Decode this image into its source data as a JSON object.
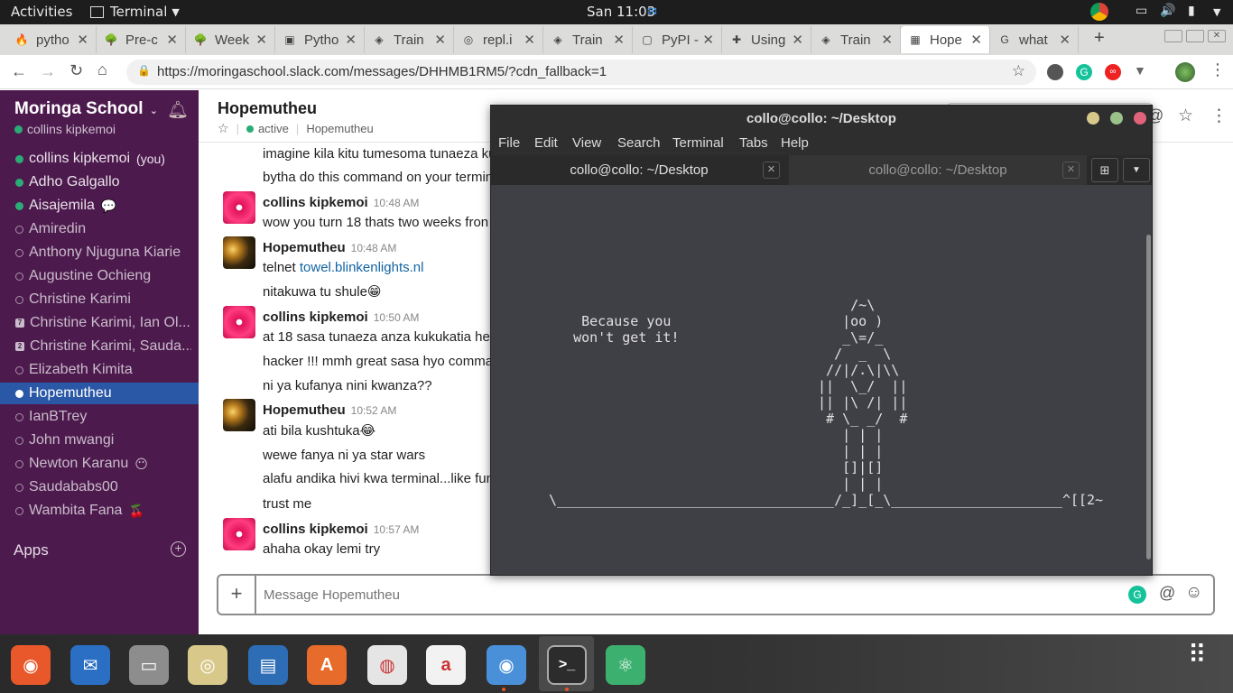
{
  "system": {
    "activities": "Activities",
    "app": "Terminal",
    "clock": "San 11:03"
  },
  "browser": {
    "tabs": [
      {
        "label": "pytho",
        "fav": "🔥"
      },
      {
        "label": "Pre-c",
        "fav": "🌳"
      },
      {
        "label": "Week",
        "fav": "🌳"
      },
      {
        "label": "Pytho",
        "fav": "▣"
      },
      {
        "label": "Train",
        "fav": "◈"
      },
      {
        "label": "repl.i",
        "fav": "◎"
      },
      {
        "label": "Train",
        "fav": "◈"
      },
      {
        "label": "PyPI -",
        "fav": "▢"
      },
      {
        "label": "Using",
        "fav": "✚"
      },
      {
        "label": "Train",
        "fav": "◈"
      },
      {
        "label": "Hope",
        "fav": "▦"
      },
      {
        "label": "what",
        "fav": "G"
      }
    ],
    "url": "https://moringaschool.slack.com/messages/DHHMB1RM5/?cdn_fallback=1"
  },
  "slack": {
    "workspace": "Moringa School",
    "user": "collins kipkemoi",
    "members": [
      {
        "name": "collins kipkemoi",
        "suffix": "(you)",
        "status": "on"
      },
      {
        "name": "Adho Galgallo",
        "suffix": "",
        "status": "on"
      },
      {
        "name": "Aisajemila",
        "suffix": "💬",
        "status": "on"
      },
      {
        "name": "Amiredin",
        "suffix": "",
        "status": "off"
      },
      {
        "name": "Anthony Njuguna Kiarie",
        "suffix": "",
        "status": "off"
      },
      {
        "name": "Augustine Ochieng",
        "suffix": "",
        "status": "off"
      },
      {
        "name": "Christine Karimi",
        "suffix": "",
        "status": "off"
      },
      {
        "name": "Christine Karimi, Ian Ol...",
        "suffix": "",
        "status": "num",
        "num": "7"
      },
      {
        "name": "Christine Karimi, Sauda...",
        "suffix": "",
        "status": "num",
        "num": "2"
      },
      {
        "name": "Elizabeth Kimita",
        "suffix": "",
        "status": "off"
      },
      {
        "name": "Hopemutheu",
        "suffix": "",
        "status": "sel"
      },
      {
        "name": "IanBTrey",
        "suffix": "",
        "status": "off"
      },
      {
        "name": "John mwangi",
        "suffix": "",
        "status": "off"
      },
      {
        "name": "Newton Karanu",
        "suffix": "😶",
        "status": "off"
      },
      {
        "name": "Saudababs00",
        "suffix": "",
        "status": "off"
      },
      {
        "name": "Wambita Fana",
        "suffix": "🍒",
        "status": "off"
      }
    ],
    "apps_label": "Apps",
    "channel": {
      "name": "Hopemutheu",
      "status": "active",
      "full_name": "Hopemutheu"
    },
    "messages": [
      {
        "text": "imagine kila kitu tumesoma tunaeza ku"
      },
      {
        "text": "bytha do this command on your termin"
      },
      {
        "author": "collins kipkemoi",
        "time": "10:48 AM",
        "avatar": "pink",
        "text": "wow you turn 18 thats two weeks fron"
      },
      {
        "author": "Hopemutheu",
        "time": "10:48 AM",
        "avatar": "dark",
        "text_prefix": "telnet ",
        "link": "towel.blinkenlights.nl"
      },
      {
        "text": "nitakuwa tu shule😁"
      },
      {
        "author": "collins kipkemoi",
        "time": "10:50 AM",
        "avatar": "pink",
        "text": "at 18 sasa tunaeza anza kukukatia heh"
      },
      {
        "text": "hacker !!! mmh great sasa hyo comman"
      },
      {
        "text": "ni ya kufanya nini kwanza??"
      },
      {
        "author": "Hopemutheu",
        "time": "10:52 AM",
        "avatar": "dark",
        "text": "ati bila kushtuka😂"
      },
      {
        "text": "wewe fanya ni ya star wars"
      },
      {
        "text": "alafu andika hivi kwa terminal...like fun"
      },
      {
        "text": "trust me"
      },
      {
        "author": "collins kipkemoi",
        "time": "10:57 AM",
        "avatar": "pink",
        "text": "ahaha okay lemi try"
      }
    ],
    "composer_placeholder": "Message Hopemutheu"
  },
  "terminal": {
    "title": "collo@collo: ~/Desktop",
    "menu": [
      "File",
      "Edit",
      "View",
      "Search",
      "Terminal",
      "Tabs",
      "Help"
    ],
    "tabs": [
      "collo@collo: ~/Desktop",
      "collo@collo: ~/Desktop"
    ],
    "ascii": "                                     /~\\\n    Because you                     |oo )\n   won't get it!                    _\\=/_\n                                   /  _  \\\n                                  //|/.\\|\\\\\n                                 ||  \\_/  ||\n                                 || |\\ /| ||\n                                  # \\_ _/  #\n                                    | | |\n                                    | | |\n                                    []|[]\n                                    | | |\n\\__________________________________/_]_[_\\_____________________^[[2~"
  },
  "dock": [
    {
      "name": "firefox-icon",
      "color": "#e8582a",
      "glyph": "◉"
    },
    {
      "name": "thunderbird-icon",
      "color": "#2a6fc4",
      "glyph": "✉"
    },
    {
      "name": "files-icon",
      "color": "#8d8d8d",
      "glyph": "▭"
    },
    {
      "name": "rhythmbox-icon",
      "color": "#d8c98b",
      "glyph": "◎"
    },
    {
      "name": "writer-icon",
      "color": "#2d6db5",
      "glyph": "▤"
    },
    {
      "name": "software-center-icon",
      "color": "#e76b2a",
      "glyph": "A"
    },
    {
      "name": "help-icon",
      "color": "#e5e5e5",
      "glyph": "◍"
    },
    {
      "name": "amazon-icon",
      "color": "#f2f2f2",
      "glyph": "a"
    },
    {
      "name": "chromium-icon",
      "color": "#4a90d9",
      "glyph": "◉"
    },
    {
      "name": "terminal-icon",
      "color": "#2c2c2c",
      "glyph": ">_"
    },
    {
      "name": "atom-icon",
      "color": "#3cb06e",
      "glyph": "⚛"
    }
  ]
}
